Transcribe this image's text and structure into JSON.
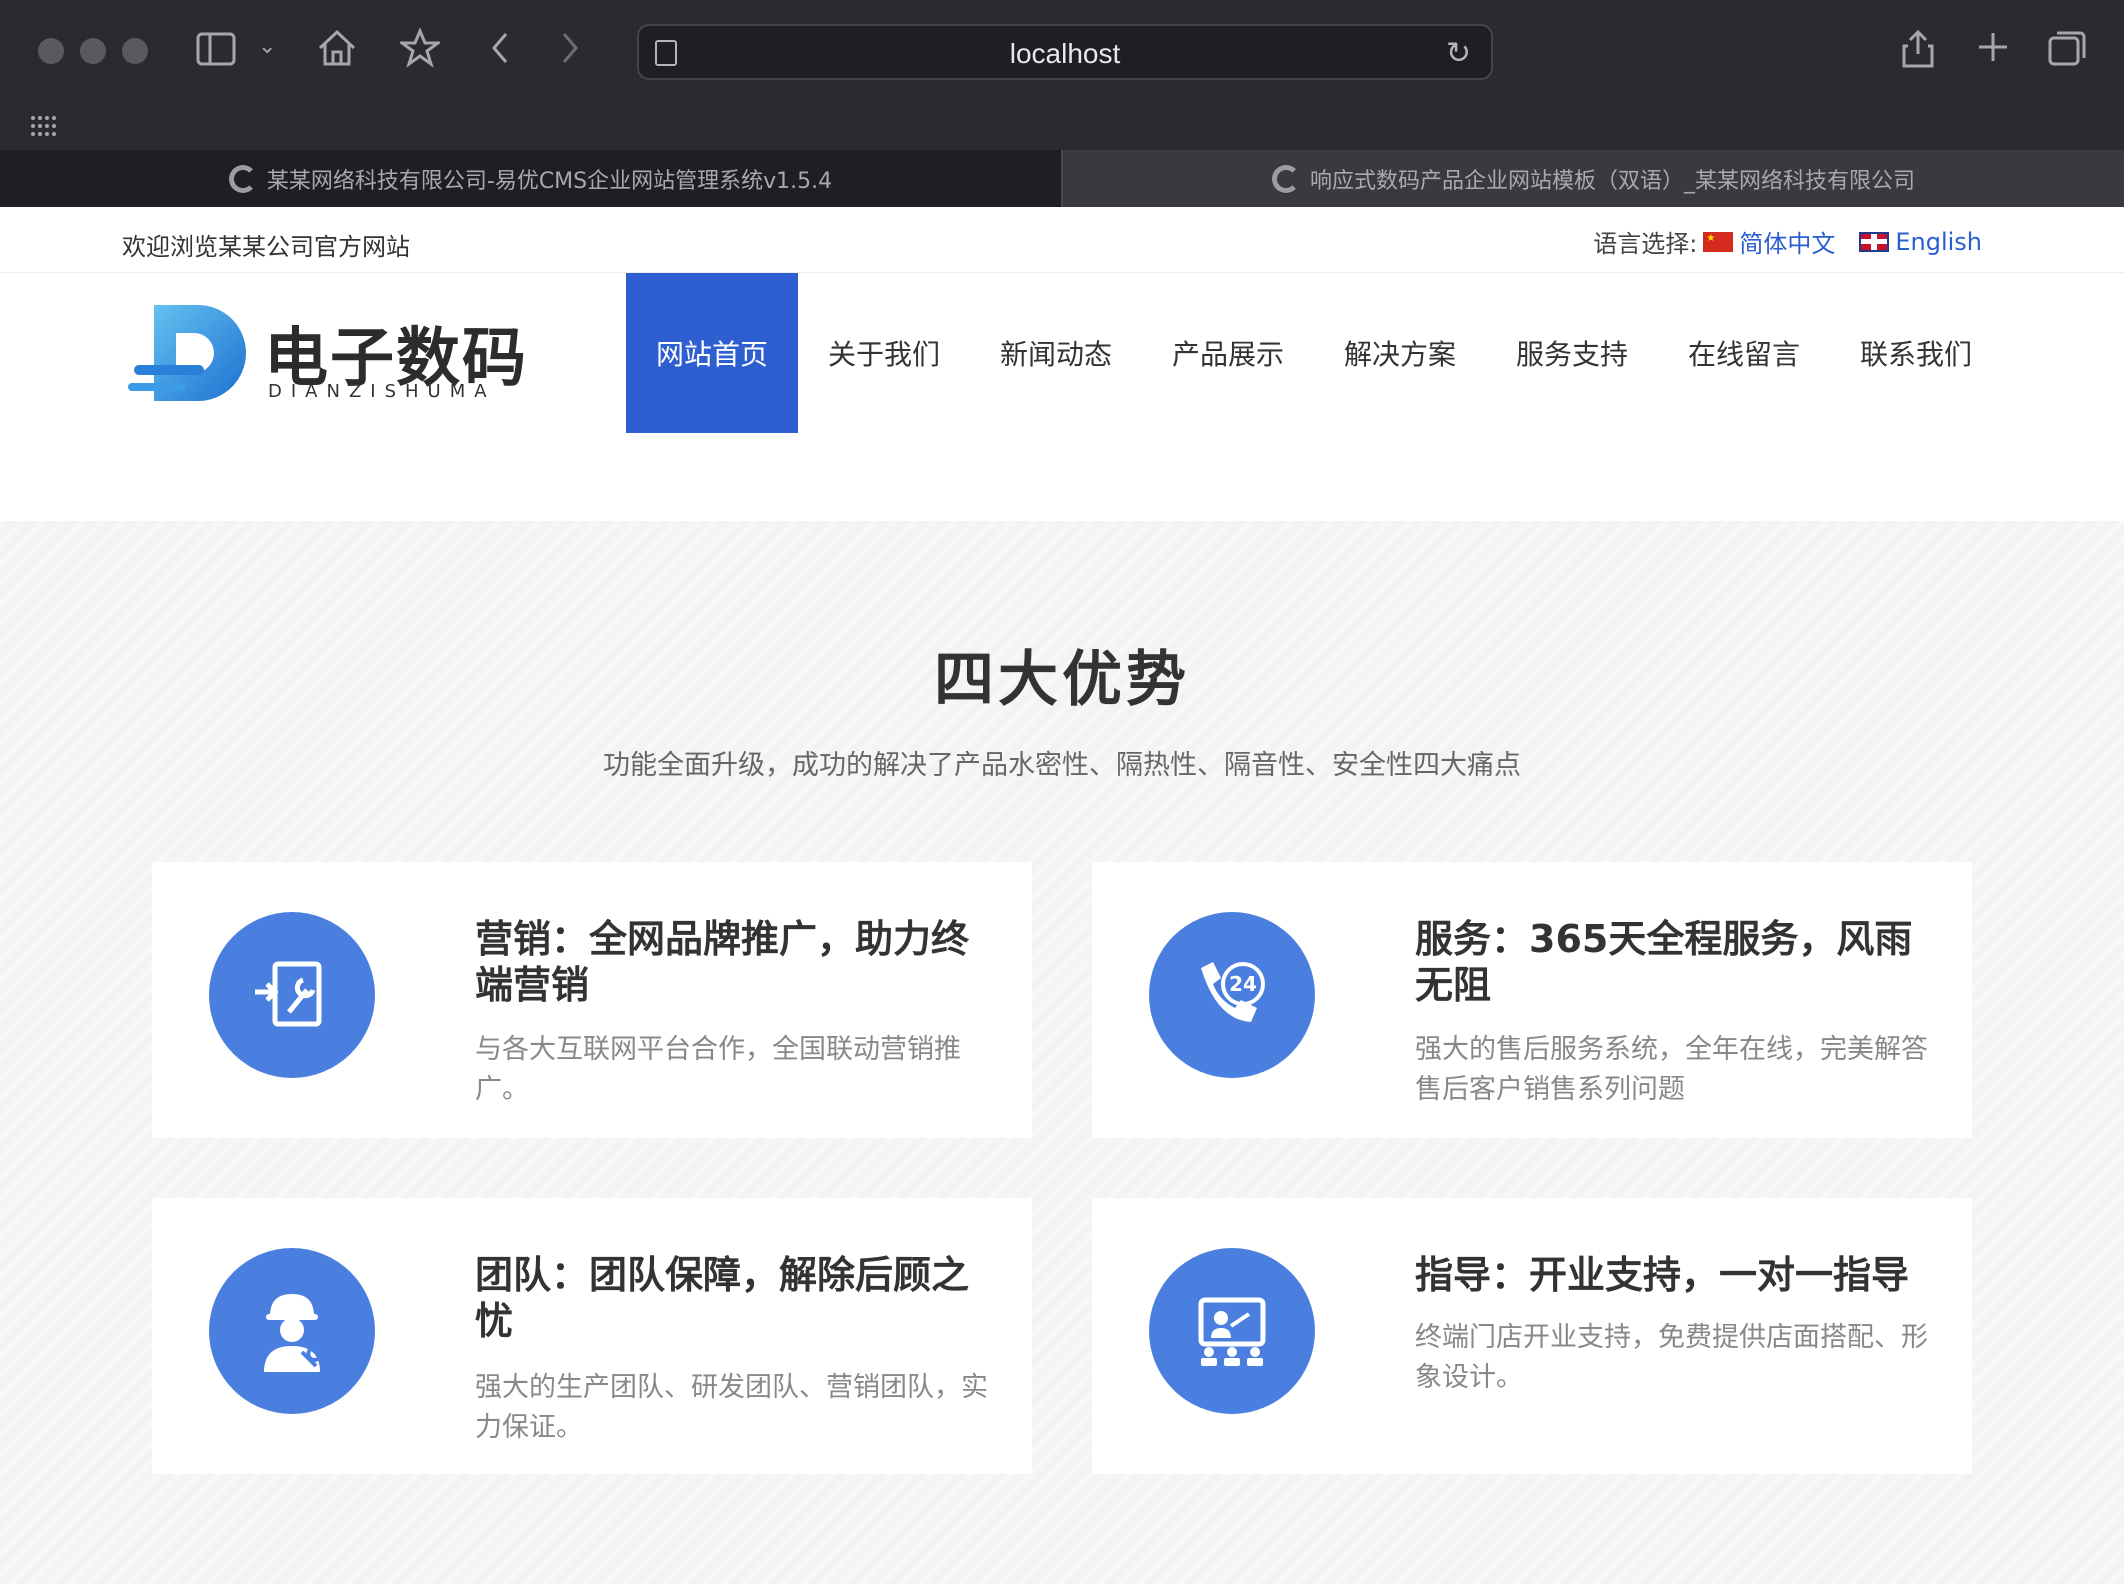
{
  "browser": {
    "url": "localhost",
    "tabs": [
      {
        "label": "某某网络科技有限公司-易优CMS企业网站管理系统v1.5.4",
        "active": true
      },
      {
        "label": "响应式数码产品企业网站模板（双语）_某某网络科技有限公司",
        "active": false
      }
    ]
  },
  "topbar": {
    "welcome": "欢迎浏览某某公司官方网站",
    "lang_label": "语言选择:",
    "lang_zh": "简体中文",
    "lang_en": "English"
  },
  "logo": {
    "title": "电子数码",
    "subtitle": "DIANZISHUMA"
  },
  "nav": {
    "items": [
      "网站首页",
      "关于我们",
      "新闻动态",
      "产品展示",
      "解决方案",
      "服务支持",
      "在线留言",
      "联系我们"
    ],
    "active_index": 0
  },
  "advantages": {
    "title": "四大优势",
    "subtitle": "功能全面升级，成功的解决了产品水密性、隔热性、隔音性、安全性四大痛点",
    "cards": [
      {
        "title": "营销：全网品牌推广，助力终端营销",
        "desc": "与各大互联网平台合作，全国联动营销推广。",
        "icon": "marketing-tool-icon"
      },
      {
        "title": "服务：365天全程服务，风雨无阻",
        "desc": "强大的售后服务系统，全年在线，完美解答售后客户销售系列问题",
        "icon": "phone-24-icon"
      },
      {
        "title": "团队：团队保障，解除后顾之忧",
        "desc": "强大的生产团队、研发团队、营销团队，实力保证。",
        "icon": "engineer-icon"
      },
      {
        "title": "指导：开业支持，一对一指导",
        "desc": "终端门店开业支持，免费提供店面搭配、形象设计。",
        "icon": "presentation-icon"
      }
    ]
  },
  "colors": {
    "accent": "#2e5fd1",
    "icon_circle": "#4a7fe0"
  }
}
